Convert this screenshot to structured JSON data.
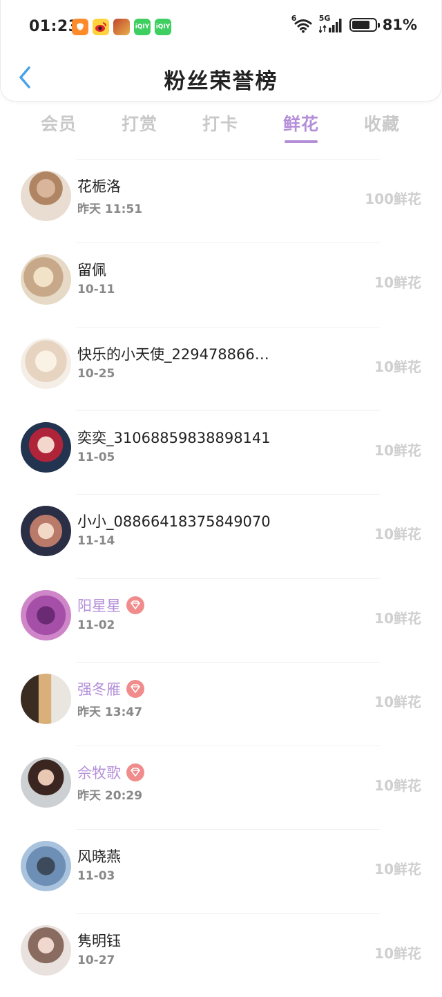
{
  "status_bar": {
    "time": "01:23",
    "app_icons": [
      {
        "icon": "taobao-icon",
        "color": "#ff8a2a"
      },
      {
        "icon": "weibo-icon",
        "color": "#ffd33d"
      },
      {
        "icon": "game-icon",
        "color": "#c1462d"
      },
      {
        "icon": "iqiyi-icon",
        "color": "#3fcf61",
        "label": "iQIY"
      },
      {
        "icon": "iqiyi-icon",
        "color": "#3fcf61",
        "label": "iQIY"
      }
    ],
    "wifi_superscript": "6",
    "network": "5G",
    "battery_level": 0.81,
    "battery_percent": "81%"
  },
  "header": {
    "title": "粉丝荣誉榜"
  },
  "tabs": [
    {
      "label": "会员",
      "active": false
    },
    {
      "label": "打赏",
      "active": false
    },
    {
      "label": "打卡",
      "active": false
    },
    {
      "label": "鲜花",
      "active": true
    },
    {
      "label": "收藏",
      "active": false
    }
  ],
  "accent_color": "#b48fd8",
  "fans": [
    {
      "name": "花栀洛",
      "time": "昨天 11:51",
      "gift": "100鲜花",
      "vip": false
    },
    {
      "name": "留佩",
      "time": "10-11",
      "gift": "10鲜花",
      "vip": false
    },
    {
      "name": "快乐的小天使_229478866…",
      "time": "10-25",
      "gift": "10鲜花",
      "vip": false
    },
    {
      "name": "奕奕_31068859838898141",
      "time": "11-05",
      "gift": "10鲜花",
      "vip": false
    },
    {
      "name": "小小_08866418375849070",
      "time": "11-14",
      "gift": "10鲜花",
      "vip": false
    },
    {
      "name": "阳星星",
      "time": "11-02",
      "gift": "10鲜花",
      "vip": true
    },
    {
      "name": "强冬雁",
      "time": "昨天 13:47",
      "gift": "10鲜花",
      "vip": true
    },
    {
      "name": "佘牧歌",
      "time": "昨天 20:29",
      "gift": "10鲜花",
      "vip": true
    },
    {
      "name": "风晓燕",
      "time": "11-03",
      "gift": "10鲜花",
      "vip": false
    },
    {
      "name": "隽明钰",
      "time": "10-27",
      "gift": "10鲜花",
      "vip": false
    }
  ]
}
